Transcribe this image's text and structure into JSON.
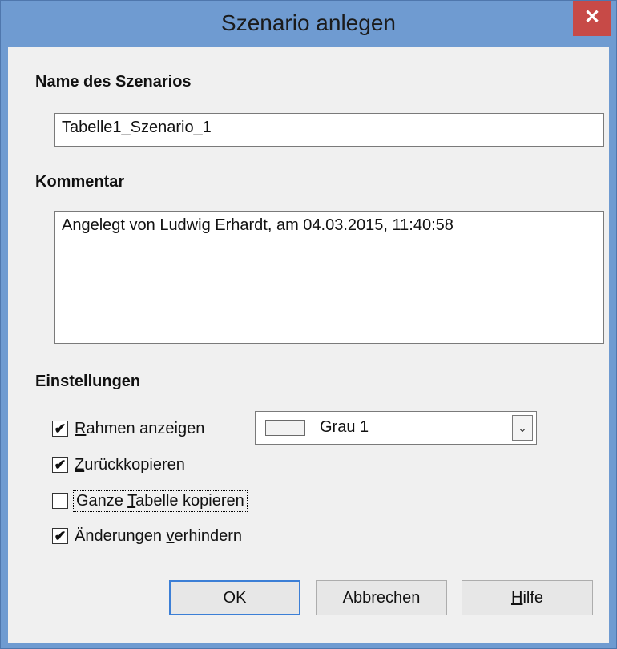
{
  "window": {
    "title": "Szenario anlegen",
    "close_glyph": "✕"
  },
  "name_section": {
    "heading": "Name des Szenarios",
    "value": "Tabelle1_Szenario_1"
  },
  "comment_section": {
    "heading": "Kommentar",
    "value": "Angelegt von Ludwig Erhardt, am 04.03.2015, 11:40:58"
  },
  "settings": {
    "heading": "Einstellungen",
    "show_border": {
      "accel": "R",
      "rest": "ahmen anzeigen",
      "checked": true
    },
    "copy_back": {
      "accel": "Z",
      "rest": "urückkopieren",
      "checked": true
    },
    "copy_sheet": {
      "pre": "Ganze ",
      "accel": "T",
      "rest": "abelle kopieren",
      "checked": false
    },
    "prevent_changes": {
      "pre": "Änderungen ",
      "accel": "v",
      "rest": "erhindern",
      "checked": true
    },
    "color_select": {
      "value": "Grau 1",
      "swatch_color": "#f2f2f2",
      "arrow_glyph": "⌄"
    }
  },
  "buttons": {
    "ok": "OK",
    "cancel": "Abbrechen",
    "help_accel": "H",
    "help_rest": "ilfe"
  },
  "icons": {
    "check": "✔"
  }
}
